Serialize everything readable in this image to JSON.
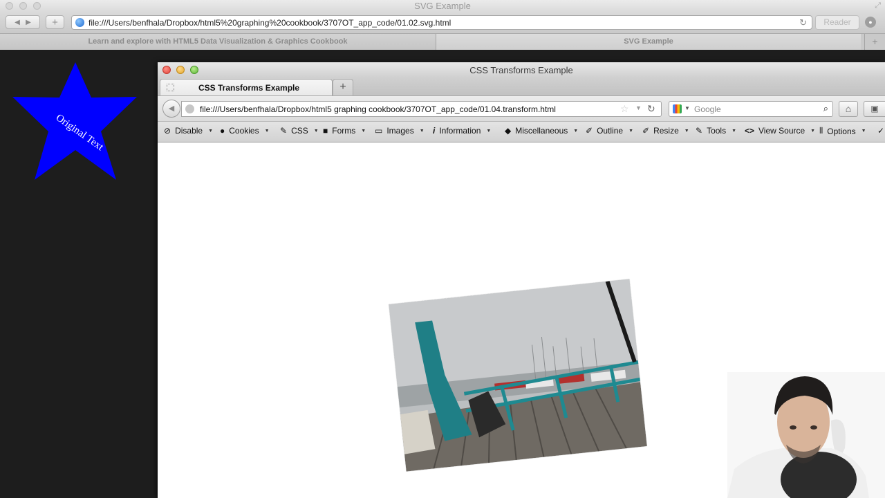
{
  "back_window": {
    "title": "SVG Example",
    "url": "file:///Users/benfhala/Dropbox/html5%20graphing%20cookbook/3707OT_app_code/01.02.svg.html",
    "reader_label": "Reader",
    "tabs": [
      {
        "label": "Learn and explore with HTML5 Data Visualization & Graphics Cookbook"
      },
      {
        "label": "SVG Example"
      }
    ],
    "star": {
      "text": "Original Text",
      "fill": "#0000ff"
    }
  },
  "front_window": {
    "title": "CSS Transforms Example",
    "tab_label": "CSS Transforms Example",
    "url": "file:///Users/benfhala/Dropbox/html5 graphing cookbook/3707OT_app_code/01.04.transform.html",
    "search_placeholder": "Google",
    "webdev_toolbar": [
      {
        "label": "Disable",
        "icon": "disable-icon"
      },
      {
        "label": "Cookies",
        "icon": "cookies-icon"
      },
      {
        "label": "CSS",
        "icon": "css-icon"
      },
      {
        "label": "Forms",
        "icon": "forms-icon"
      },
      {
        "label": "Images",
        "icon": "images-icon"
      },
      {
        "label": "Information",
        "icon": "information-icon"
      },
      {
        "label": "Miscellaneous",
        "icon": "miscellaneous-icon"
      },
      {
        "label": "Outline",
        "icon": "outline-icon"
      },
      {
        "label": "Resize",
        "icon": "resize-icon"
      },
      {
        "label": "Tools",
        "icon": "tools-icon"
      },
      {
        "label": "View Source",
        "icon": "view-source-icon"
      },
      {
        "label": "Options",
        "icon": "options-icon"
      }
    ],
    "content": {
      "photo_rotation_deg": -6
    }
  },
  "colors": {
    "star_fill": "#0000ff",
    "dark_background": "#1d1d1d"
  }
}
